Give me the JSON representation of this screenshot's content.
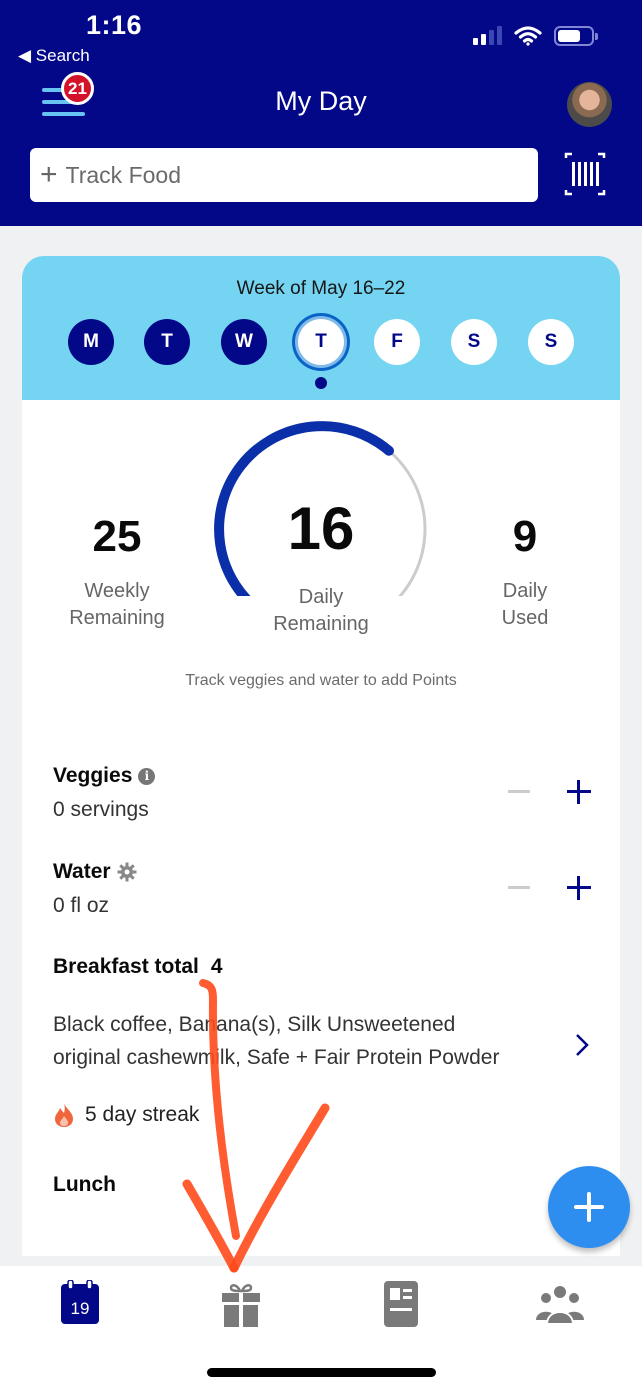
{
  "status_bar": {
    "time": "1:16",
    "back_label": "◀ Search",
    "signal_bars_active": 2,
    "signal_bars_total": 4,
    "battery_level": 0.7
  },
  "header": {
    "title": "My Day",
    "notification_count": "21",
    "menu_icon": "hamburger-menu-icon",
    "avatar_icon": "user-avatar",
    "track_food_placeholder": "Track Food",
    "barcode_icon": "barcode-scanner-icon"
  },
  "week": {
    "title": "Week of May 16–22",
    "days": [
      {
        "label": "M",
        "state": "past"
      },
      {
        "label": "T",
        "state": "past"
      },
      {
        "label": "W",
        "state": "past"
      },
      {
        "label": "T",
        "state": "current"
      },
      {
        "label": "F",
        "state": "future"
      },
      {
        "label": "S",
        "state": "future"
      },
      {
        "label": "S",
        "state": "future"
      }
    ]
  },
  "points": {
    "weekly_remaining": {
      "value": "25",
      "label_1": "Weekly",
      "label_2": "Remaining"
    },
    "daily_remaining": {
      "value": "16",
      "label_1": "Daily",
      "label_2": "Remaining"
    },
    "daily_used": {
      "value": "9",
      "label_1": "Daily",
      "label_2": "Used"
    },
    "gauge_fraction": 0.64,
    "hint": "Track veggies and water to add Points",
    "colors": {
      "gauge_fill": "#0a2fa8",
      "gauge_track": "#cccccc"
    }
  },
  "trackers": {
    "veggies": {
      "title": "Veggies",
      "value": "0 servings",
      "icon": "info-icon"
    },
    "water": {
      "title": "Water",
      "value": "0 fl oz",
      "icon": "gear-icon"
    }
  },
  "meals": {
    "breakfast": {
      "title": "Breakfast total",
      "points": "4",
      "items_line_1": "Black coffee, Banana(s), Silk Unsweetened",
      "items_line_2": "original cashewmilk, Safe + Fair Protein Powder"
    },
    "streak": "5 day streak",
    "lunch": {
      "title": "Lunch"
    }
  },
  "bottom_nav": {
    "items": [
      {
        "name": "my-day",
        "icon": "calendar-icon",
        "text": "19",
        "active": true
      },
      {
        "name": "rewards",
        "icon": "gift-icon",
        "active": false
      },
      {
        "name": "articles",
        "icon": "article-icon",
        "active": false
      },
      {
        "name": "community",
        "icon": "people-icon",
        "active": false
      }
    ]
  },
  "colors": {
    "brand_navy": "#020887",
    "week_band": "#74d4f1",
    "fab": "#2d8ef0",
    "badge_red": "#d3122a",
    "annotation": "#ff4a1c"
  }
}
